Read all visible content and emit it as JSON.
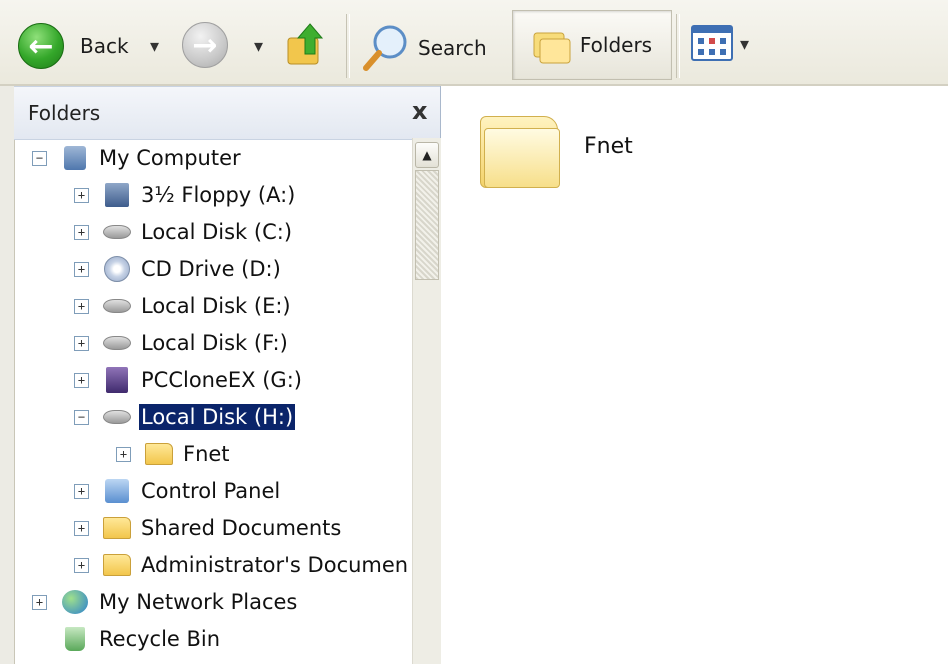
{
  "toolbar": {
    "back_label": "Back",
    "search_label": "Search",
    "folders_label": "Folders",
    "icons": {
      "back": "back-arrow-icon",
      "forward": "forward-arrow-icon",
      "up": "up-folder-icon",
      "search": "magnifier-icon",
      "folders": "folders-icon",
      "views": "views-icon"
    }
  },
  "folders_pane": {
    "title": "Folders",
    "close_glyph": "x",
    "tree": [
      {
        "label": "My Computer",
        "icon": "computer-icon",
        "expander": "−"
      },
      {
        "label": "3½ Floppy (A:)",
        "icon": "floppy-icon",
        "expander": "+"
      },
      {
        "label": "Local Disk (C:)",
        "icon": "drive-icon",
        "expander": "+"
      },
      {
        "label": "CD Drive (D:)",
        "icon": "cd-drive-icon",
        "expander": "+"
      },
      {
        "label": "Local Disk (E:)",
        "icon": "drive-icon",
        "expander": "+"
      },
      {
        "label": "Local Disk (F:)",
        "icon": "drive-icon",
        "expander": "+"
      },
      {
        "label": "PCCloneEX (G:)",
        "icon": "pcclone-icon",
        "expander": "+"
      },
      {
        "label": "Local Disk (H:)",
        "icon": "drive-icon",
        "expander": "−",
        "selected": true
      },
      {
        "label": "Fnet",
        "icon": "folder-icon",
        "expander": "+"
      },
      {
        "label": "Control Panel",
        "icon": "control-panel-icon",
        "expander": "+"
      },
      {
        "label": "Shared Documents",
        "icon": "folder-icon",
        "expander": "+"
      },
      {
        "label": "Administrator's Documen",
        "icon": "folder-icon",
        "expander": "+"
      },
      {
        "label": "My Network Places",
        "icon": "network-icon",
        "expander": "+"
      },
      {
        "label": "Recycle Bin",
        "icon": "recycle-bin-icon",
        "expander": ""
      }
    ]
  },
  "content": {
    "items": [
      {
        "label": "Fnet",
        "icon": "folder-icon"
      }
    ]
  },
  "colors": {
    "selection": "#0a246a",
    "toolbar": "#ebe9dd",
    "pane_header": "#e3e8f1"
  }
}
